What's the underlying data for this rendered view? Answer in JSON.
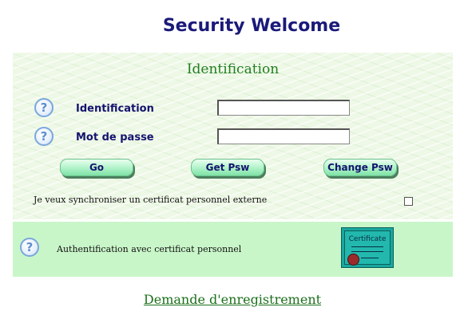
{
  "header": {
    "title": "Security Welcome"
  },
  "login_panel": {
    "title": "Identification",
    "fields": {
      "identification": {
        "label": "Identification",
        "value": "",
        "help_icon": "question-mark-icon"
      },
      "password": {
        "label": "Mot de passe",
        "value": "",
        "help_icon": "question-mark-icon"
      }
    },
    "buttons": {
      "go": "Go",
      "get_psw": "Get Psw",
      "change_psw": "Change Psw"
    },
    "sync_certificate": {
      "label": "Je veux synchroniser un certificat personnel externe",
      "checked": false
    }
  },
  "certificate_panel": {
    "help_icon": "question-mark-icon",
    "label": "Authentification avec certificat personnel",
    "certificate_icon_text": "Certificate"
  },
  "footer": {
    "register_link": "Demande d'enregistrement"
  },
  "colors": {
    "title": "#1a1a7a",
    "panel_title": "#1f7f1f",
    "button_bg": "#b9f5cf",
    "certificate_panel_bg": "#c9f6c9",
    "link": "#1b6f1b"
  }
}
